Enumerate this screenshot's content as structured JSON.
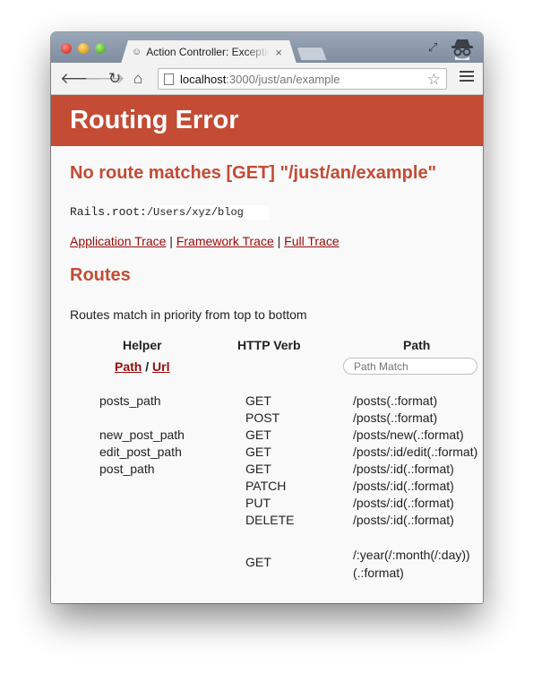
{
  "browser": {
    "tab_title": "Action Controller: Exception",
    "tab_close": "×",
    "url_host": "localhost",
    "url_path": ":3000/just/an/example"
  },
  "page": {
    "header_title": "Routing Error",
    "error_message": "No route matches [GET] \"/just/an/example\"",
    "rails_root_label": "Rails.root:",
    "rails_root_value": "/Users/xyz/blog",
    "traces": {
      "application": "Application Trace",
      "framework": "Framework Trace",
      "full": "Full Trace",
      "separator": " | "
    },
    "routes_heading": "Routes",
    "routes_description": "Routes match in priority from top to bottom",
    "table": {
      "headers": {
        "helper": "Helper",
        "verb": "HTTP Verb",
        "path": "Path"
      },
      "path_link": "Path",
      "slash": " / ",
      "url_link": "Url",
      "path_match_placeholder": "Path Match",
      "rows": [
        {
          "helper": "posts_path",
          "verb": "GET",
          "path": "/posts(.:format)"
        },
        {
          "helper": "",
          "verb": "POST",
          "path": "/posts(.:format)"
        },
        {
          "helper": "new_post_path",
          "verb": "GET",
          "path": "/posts/new(.:format)"
        },
        {
          "helper": "edit_post_path",
          "verb": "GET",
          "path": "/posts/:id/edit(.:format)"
        },
        {
          "helper": "post_path",
          "verb": "GET",
          "path": "/posts/:id(.:format)"
        },
        {
          "helper": "",
          "verb": "PATCH",
          "path": "/posts/:id(.:format)"
        },
        {
          "helper": "",
          "verb": "PUT",
          "path": "/posts/:id(.:format)"
        },
        {
          "helper": "",
          "verb": "DELETE",
          "path": "/posts/:id(.:format)"
        },
        {
          "helper": "",
          "verb": "GET",
          "path_line1": "/:year(/:month(/:day))",
          "path_line2": "(.:format)"
        }
      ]
    }
  },
  "colors": {
    "header_bg": "#c44b34",
    "heading_red": "#c44b34",
    "link": "#960b0b"
  }
}
